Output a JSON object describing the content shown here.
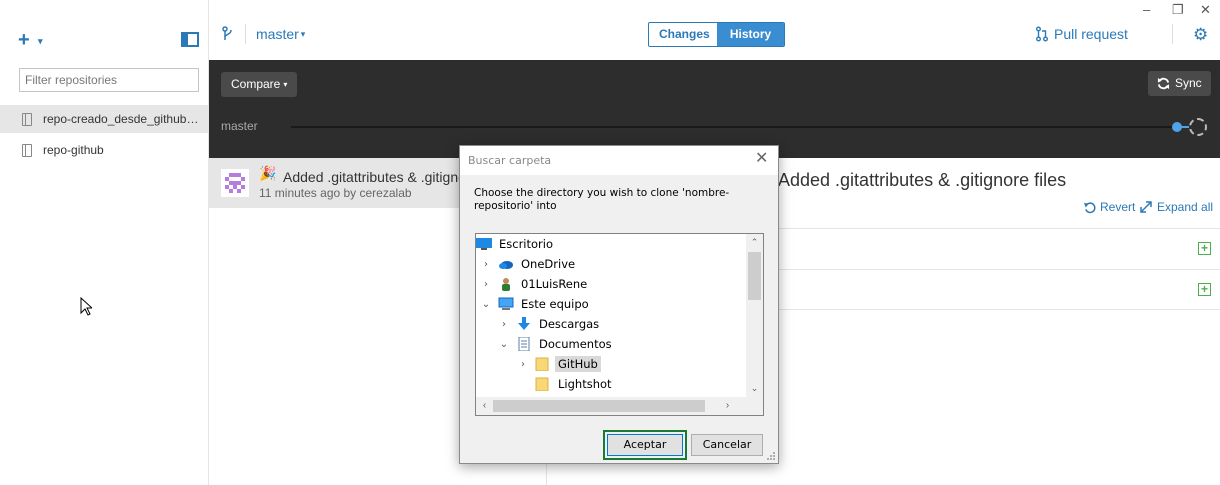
{
  "window": {
    "controls": [
      "–",
      "❐",
      "✕"
    ]
  },
  "sidebar": {
    "add_caret": "▾",
    "filter_placeholder": "Filter repositories",
    "repos": [
      {
        "label": "repo-creado_desde_github_...",
        "selected": true
      },
      {
        "label": "repo-github",
        "selected": false
      }
    ]
  },
  "topbar": {
    "branch": "master",
    "caret": "▾",
    "tabs": [
      "Changes",
      "History"
    ],
    "active_tab": "History",
    "pull_request": "Pull request"
  },
  "timeline": {
    "compare_label": "Compare",
    "sync_label": "Sync",
    "branch_label": "master"
  },
  "commit": {
    "title": "Added .gitattributes & .gitignore files",
    "meta": "11 minutes ago by cerezalab"
  },
  "detail": {
    "title": "Added .gitattributes & .gitignore files",
    "revert_label": "Revert",
    "expand_label": "Expand all"
  },
  "dialog": {
    "title": "Buscar carpeta",
    "message": "Choose the directory you wish to clone 'nombre-repositorio' into",
    "tree": [
      {
        "label": "Escritorio",
        "level": 0,
        "chevron": "",
        "icon": "desktop-icon"
      },
      {
        "label": "OneDrive",
        "level": 1,
        "chevron": "›",
        "icon": "onedrive-icon"
      },
      {
        "label": "01LuisRene",
        "level": 1,
        "chevron": "›",
        "icon": "user-icon"
      },
      {
        "label": "Este equipo",
        "level": 1,
        "chevron": "⌄",
        "icon": "computer-icon"
      },
      {
        "label": "Descargas",
        "level": 2,
        "chevron": "›",
        "icon": "download-icon"
      },
      {
        "label": "Documentos",
        "level": 2,
        "chevron": "⌄",
        "icon": "documents-icon"
      },
      {
        "label": "GitHub",
        "level": 3,
        "chevron": "›",
        "icon": "folder-icon",
        "selected": true
      },
      {
        "label": "Lightshot",
        "level": 3,
        "chevron": "",
        "icon": "folder-icon"
      }
    ],
    "ok_label": "Aceptar",
    "cancel_label": "Cancelar"
  }
}
